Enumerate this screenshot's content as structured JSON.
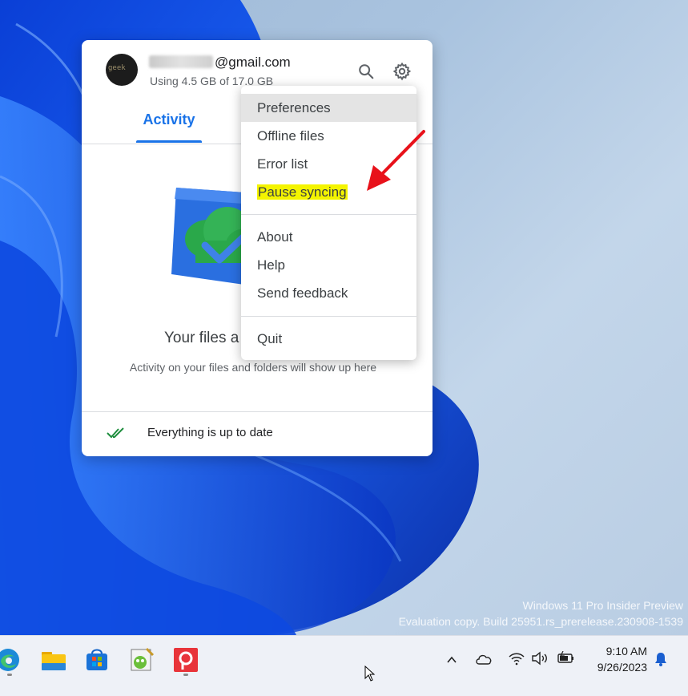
{
  "panel": {
    "email": "@gmail.com",
    "avatar_text": "geek",
    "usage": "Using 4.5 GB of 17.0 GB",
    "tab_activity": "Activity",
    "empty_title": "Your files a",
    "empty_desc": "Activity on your files and folders will show up here",
    "status": "Everything is up to date"
  },
  "menu": {
    "preferences": "Preferences",
    "offline_files": "Offline files",
    "error_list": "Error list",
    "pause_syncing": "Pause syncing",
    "about": "About",
    "help": "Help",
    "send_feedback": "Send feedback",
    "quit": "Quit"
  },
  "watermark": {
    "line1": "Windows 11 Pro Insider Preview",
    "line2": "Evaluation copy. Build 25951.rs_prerelease.230908-1539"
  },
  "taskbar": {
    "time": "9:10 AM",
    "date": "9/26/2023",
    "icons": [
      "edge-icon",
      "file-explorer-icon",
      "microsoft-store-icon",
      "notepad-icon",
      "app-p-icon"
    ]
  },
  "colors": {
    "accent": "#1a73e8",
    "highlight": "#f4f400",
    "annotation_arrow": "#e8111a"
  }
}
